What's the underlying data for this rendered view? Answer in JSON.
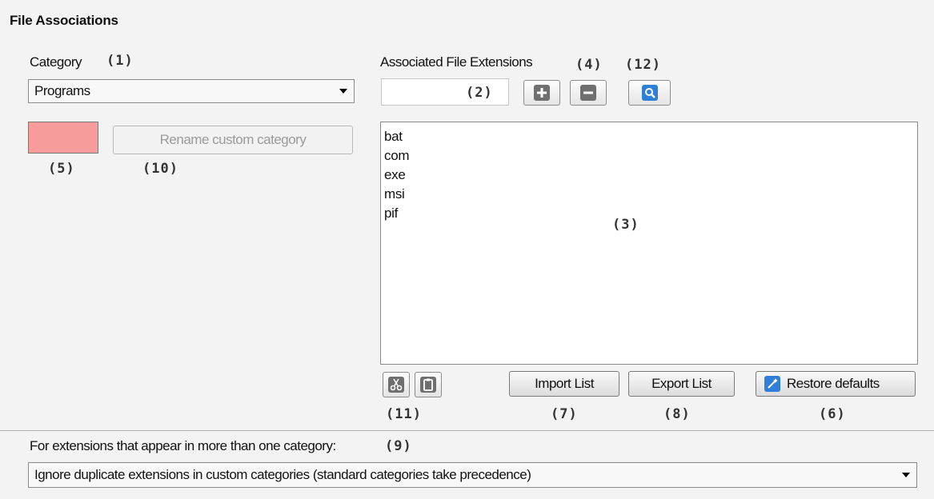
{
  "header": {
    "title": "File Associations"
  },
  "category": {
    "label": "Category",
    "callout": "(1)",
    "selected": "Programs",
    "color": "#f89b9b",
    "color_callout": "(5)"
  },
  "rename": {
    "label": "Rename custom category",
    "callout": "(10)"
  },
  "extensions": {
    "label": "Associated File Extensions",
    "input_callout": "(2)",
    "add_remove_callout": "(4)",
    "search_callout": "(12)",
    "list_callout": "(3)",
    "items": [
      "bat",
      "com",
      "exe",
      "msi",
      "pif"
    ]
  },
  "actions": {
    "clip_callout": "(11)",
    "import_label": "Import List",
    "import_callout": "(7)",
    "export_label": "Export List",
    "export_callout": "(8)",
    "restore_label": "Restore defaults",
    "restore_callout": "(6)"
  },
  "duplicates": {
    "label": "For extensions that appear in more than one category:",
    "callout": "(9)",
    "selected": "Ignore duplicate extensions in custom categories (standard categories take precedence)"
  },
  "colors": {
    "accent": "#2f7fd8",
    "background": "#f3f3f3"
  }
}
